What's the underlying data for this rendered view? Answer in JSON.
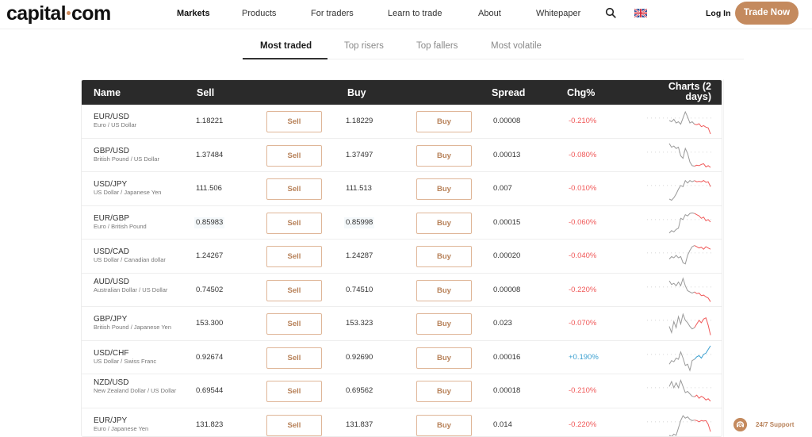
{
  "header": {
    "logo": "capital·com",
    "logo_left": "capital",
    "logo_right": "com",
    "nav": [
      {
        "label": "Markets",
        "active": true
      },
      {
        "label": "Products",
        "active": false
      },
      {
        "label": "For traders",
        "active": false
      },
      {
        "label": "Learn to trade",
        "active": false
      },
      {
        "label": "About",
        "active": false
      },
      {
        "label": "Whitepaper",
        "active": false
      }
    ],
    "search_icon": "search-icon",
    "language_icon": "uk-flag-icon",
    "login_label": "Log In",
    "cta_label": "Trade Now"
  },
  "tabs": [
    {
      "label": "Most traded",
      "active": true
    },
    {
      "label": "Top risers",
      "active": false
    },
    {
      "label": "Top fallers",
      "active": false
    },
    {
      "label": "Most volatile",
      "active": false
    }
  ],
  "table": {
    "columns": [
      "Name",
      "Sell",
      "Buy",
      "Spread",
      "Chg%",
      "Charts (2",
      "days)"
    ],
    "sell_button_label": "Sell",
    "buy_button_label": "Buy",
    "rows": [
      {
        "pair": "EUR/USD",
        "desc": "Euro / US Dollar",
        "sell": "1.18221",
        "buy": "1.18229",
        "spread": "0.00008",
        "chg": "-0.210%",
        "dir": "neg",
        "spark": [
          0.45,
          0.5,
          0.4,
          0.55,
          0.5,
          0.6,
          0.35,
          0.1,
          0.3,
          0.55,
          0.5,
          0.6,
          0.62,
          0.58,
          0.7,
          0.66,
          0.72,
          0.75,
          1.0
        ]
      },
      {
        "pair": "GBP/USD",
        "desc": "British Pound / US Dollar",
        "sell": "1.37484",
        "buy": "1.37497",
        "spread": "0.00013",
        "chg": "-0.080%",
        "dir": "neg",
        "spark": [
          0.0,
          0.15,
          0.1,
          0.2,
          0.15,
          0.5,
          0.6,
          0.2,
          0.4,
          0.75,
          0.9,
          0.92,
          0.88,
          0.9,
          0.85,
          0.82,
          0.95,
          0.9,
          0.97
        ]
      },
      {
        "pair": "USD/JPY",
        "desc": "US Dollar / Japanese Yen",
        "sell": "111.506",
        "buy": "111.513",
        "spread": "0.007",
        "chg": "-0.010%",
        "dir": "neg",
        "spark": [
          0.9,
          0.95,
          0.85,
          0.7,
          0.5,
          0.35,
          0.4,
          0.15,
          0.25,
          0.15,
          0.2,
          0.15,
          0.2,
          0.18,
          0.2,
          0.15,
          0.22,
          0.2,
          0.4
        ]
      },
      {
        "pair": "EUR/GBP",
        "desc": "Euro / British Pound",
        "sell": "0.85983",
        "buy": "0.85998",
        "spread": "0.00015",
        "chg": "-0.060%",
        "dir": "neg",
        "spark": [
          0.9,
          0.8,
          0.85,
          0.75,
          0.7,
          0.3,
          0.35,
          0.15,
          0.2,
          0.1,
          0.08,
          0.1,
          0.15,
          0.2,
          0.3,
          0.25,
          0.4,
          0.35,
          0.45
        ]
      },
      {
        "pair": "USD/CAD",
        "desc": "US Dollar / Canadian dollar",
        "sell": "1.24267",
        "buy": "1.24287",
        "spread": "0.00020",
        "chg": "-0.040%",
        "dir": "neg",
        "spark": [
          0.6,
          0.5,
          0.55,
          0.45,
          0.55,
          0.5,
          0.75,
          0.8,
          0.45,
          0.25,
          0.1,
          0.05,
          0.1,
          0.15,
          0.12,
          0.2,
          0.1,
          0.15,
          0.2
        ]
      },
      {
        "pair": "AUD/USD",
        "desc": "Australian Dollar / US Dollar",
        "sell": "0.74502",
        "buy": "0.74510",
        "spread": "0.00008",
        "chg": "-0.220%",
        "dir": "neg",
        "spark": [
          0.1,
          0.25,
          0.2,
          0.3,
          0.15,
          0.3,
          0.0,
          0.3,
          0.5,
          0.55,
          0.6,
          0.55,
          0.62,
          0.6,
          0.7,
          0.68,
          0.75,
          0.8,
          0.95
        ]
      },
      {
        "pair": "GBP/JPY",
        "desc": "British Pound / Japanese Yen",
        "sell": "153.300",
        "buy": "153.323",
        "spread": "0.023",
        "chg": "-0.070%",
        "dir": "neg",
        "spark": [
          0.6,
          0.85,
          0.4,
          0.65,
          0.2,
          0.5,
          0.1,
          0.35,
          0.45,
          0.6,
          0.7,
          0.65,
          0.5,
          0.35,
          0.45,
          0.3,
          0.25,
          0.55,
          0.95
        ]
      },
      {
        "pair": "USD/CHF",
        "desc": "US Dollar / Swiss Franc",
        "sell": "0.92674",
        "buy": "0.92690",
        "spread": "0.00016",
        "chg": "+0.190%",
        "dir": "pos",
        "spark": [
          0.75,
          0.6,
          0.65,
          0.5,
          0.55,
          0.25,
          0.5,
          0.8,
          0.75,
          1.0,
          0.6,
          0.55,
          0.45,
          0.4,
          0.5,
          0.35,
          0.3,
          0.15,
          0.0
        ]
      },
      {
        "pair": "NZD/USD",
        "desc": "New Zealand Dollar / US Dollar",
        "sell": "0.69544",
        "buy": "0.69562",
        "spread": "0.00018",
        "chg": "-0.210%",
        "dir": "neg",
        "spark": [
          0.3,
          0.1,
          0.35,
          0.15,
          0.35,
          0.05,
          0.3,
          0.55,
          0.5,
          0.6,
          0.7,
          0.72,
          0.65,
          0.78,
          0.7,
          0.75,
          0.85,
          0.8,
          0.9
        ]
      },
      {
        "pair": "EUR/JPY",
        "desc": "Euro / Japanese Yen",
        "sell": "131.823",
        "buy": "131.837",
        "spread": "0.014",
        "chg": "-0.220%",
        "dir": "neg",
        "spark": [
          0.9,
          0.95,
          0.85,
          0.9,
          0.6,
          0.3,
          0.1,
          0.2,
          0.15,
          0.25,
          0.3,
          0.28,
          0.3,
          0.35,
          0.3,
          0.32,
          0.3,
          0.45,
          0.75
        ]
      }
    ]
  },
  "support": {
    "label": "24/7 Support",
    "icon": "headset-icon"
  },
  "colors": {
    "accent": "#c48a5e",
    "negative": "#f05a5a",
    "positive": "#3a9fd0",
    "header_bg": "#2a2a2a"
  }
}
